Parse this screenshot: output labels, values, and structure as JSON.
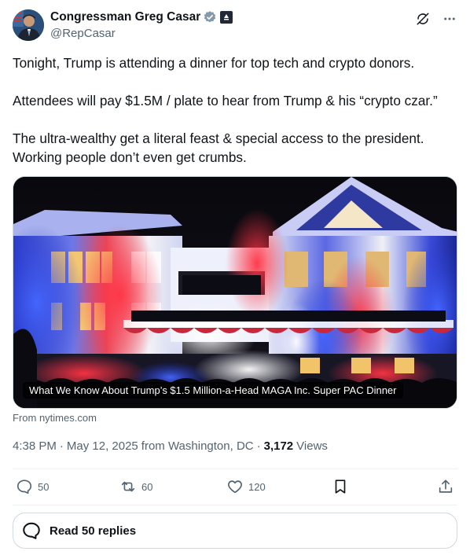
{
  "author": {
    "display_name": "Congressman Greg Casar",
    "handle": "@RepCasar",
    "verified_icon": "verified-badge-icon",
    "affiliation_icon": "government-badge-icon"
  },
  "header_icons": [
    "grok-icon",
    "more-icon"
  ],
  "tweet": {
    "paragraphs": [
      "Tonight, Trump is attending a dinner for top tech and crypto donors.",
      "Attendees will pay $1.5M / plate to hear from Trump & his “crypto czar.”",
      "The ultra-wealthy get a literal feast & special access to the president. Working people don’t even get crumbs."
    ]
  },
  "card": {
    "caption": "What We Know About Trump’s $1.5 Million-a-Head MAGA Inc. Super PAC Dinner",
    "source": "From nytimes.com"
  },
  "meta": {
    "time": "4:38 PM",
    "separator": "·",
    "date": "May 12, 2025",
    "location": "from Washington, DC",
    "views_count": "3,172",
    "views_label": "Views"
  },
  "actions": {
    "replies": "50",
    "reposts": "60",
    "likes": "120"
  },
  "read_replies_label": "Read 50 replies",
  "colors": {
    "text": "#0f1419",
    "muted": "#536471",
    "border": "#cfd9de",
    "verified": "#829aab"
  }
}
